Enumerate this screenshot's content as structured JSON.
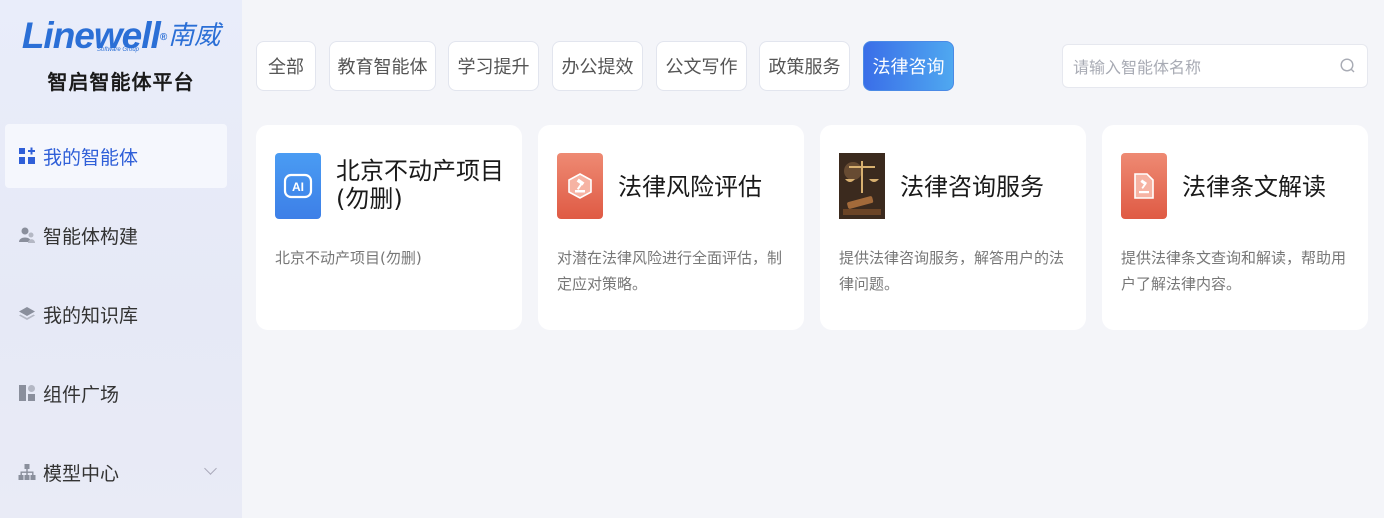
{
  "brand": {
    "logo_latin": "Linewell",
    "logo_reg": "®",
    "logo_cn": "南威",
    "logo_sub": "Software Group",
    "platform_title": "智启智能体平台",
    "brand_color": "#2b6fd6"
  },
  "sidebar": {
    "items": [
      {
        "label": "我的智能体",
        "icon": "grid-plus-icon",
        "active": true
      },
      {
        "label": "智能体构建",
        "icon": "users-icon",
        "active": false
      },
      {
        "label": "我的知识库",
        "icon": "layers-icon",
        "active": false
      },
      {
        "label": "组件广场",
        "icon": "components-icon",
        "active": false
      },
      {
        "label": "模型中心",
        "icon": "hierarchy-icon",
        "active": false,
        "expandable": true
      }
    ]
  },
  "tabs": [
    {
      "label": "全部",
      "active": false
    },
    {
      "label": "教育智能体",
      "active": false
    },
    {
      "label": "学习提升",
      "active": false
    },
    {
      "label": "办公提效",
      "active": false
    },
    {
      "label": "公文写作",
      "active": false
    },
    {
      "label": "政策服务",
      "active": false
    },
    {
      "label": "法律咨询",
      "active": true
    }
  ],
  "search": {
    "placeholder": "请输入智能体名称",
    "value": ""
  },
  "cards": [
    {
      "title": "北京不动产项目(勿删)",
      "description": "北京不动产项目(勿删)",
      "icon": "ai-icon"
    },
    {
      "title": "法律风险评估",
      "description": "对潜在法律风险进行全面评估，制定应对策略。",
      "icon": "gavel-badge-icon"
    },
    {
      "title": "法律咨询服务",
      "description": "提供法律咨询服务，解答用户的法律问题。",
      "icon": "justice-photo-icon"
    },
    {
      "title": "法律条文解读",
      "description": "提供法律条文查询和解读，帮助用户了解法律内容。",
      "icon": "law-document-icon"
    }
  ],
  "colors": {
    "accent": "#3a6ee8",
    "accent_light": "#4fa8f0",
    "active_nav_text": "#2f5fd8",
    "card_icon_red": "#e0614a"
  }
}
